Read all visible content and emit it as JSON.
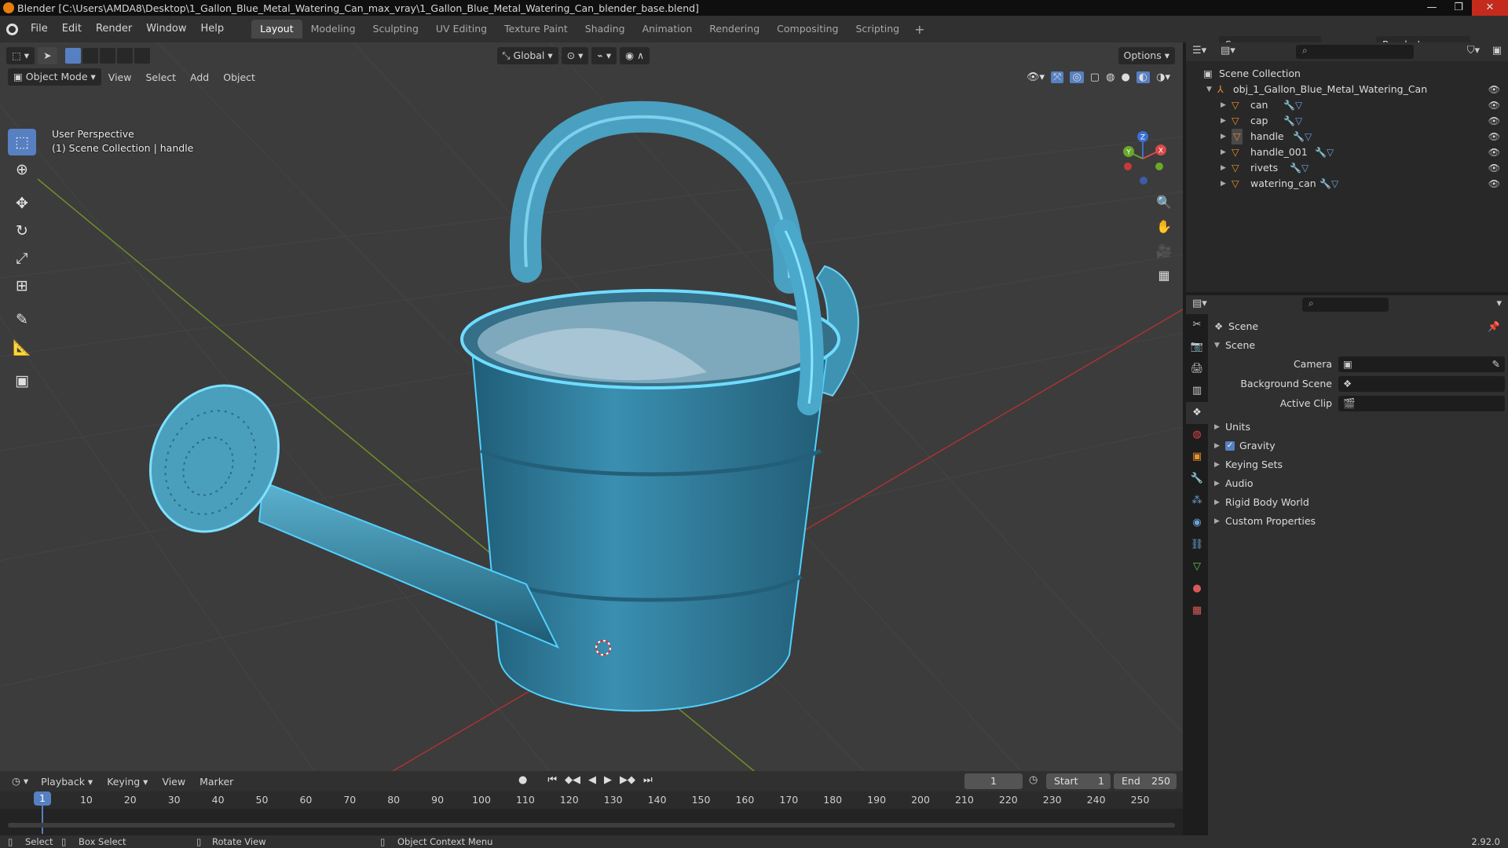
{
  "window": {
    "title": "Blender [C:\\Users\\AMDA8\\Desktop\\1_Gallon_Blue_Metal_Watering_Can_max_vray\\1_Gallon_Blue_Metal_Watering_Can_blender_base.blend]",
    "controls": [
      "—",
      "❐",
      "✕"
    ]
  },
  "menu": [
    "File",
    "Edit",
    "Render",
    "Window",
    "Help"
  ],
  "workspaces": [
    "Layout",
    "Modeling",
    "Sculpting",
    "UV Editing",
    "Texture Paint",
    "Shading",
    "Animation",
    "Rendering",
    "Compositing",
    "Scripting"
  ],
  "active_workspace": "Layout",
  "scene_name": "Scene",
  "view_layer": "RenderLayer",
  "viewport": {
    "mode": "Object Mode",
    "menus": [
      "View",
      "Select",
      "Add",
      "Object"
    ],
    "transform_orientation": "Global",
    "options_label": "Options",
    "info_line1": "User Perspective",
    "info_line2": "(1) Scene Collection | handle",
    "gizmo_axes": [
      "X",
      "Y",
      "Z"
    ]
  },
  "outliner": {
    "root": "Scene Collection",
    "collection": "obj_1_Gallon_Blue_Metal_Watering_Can",
    "objects": [
      "can",
      "cap",
      "handle",
      "handle_001",
      "rivets",
      "watering_can"
    ]
  },
  "properties": {
    "context": "Scene",
    "panel": "Scene",
    "fields": [
      {
        "label": "Camera"
      },
      {
        "label": "Background Scene"
      },
      {
        "label": "Active Clip"
      }
    ],
    "sections": [
      "Units",
      "Gravity",
      "Keying Sets",
      "Audio",
      "Rigid Body World",
      "Custom Properties"
    ],
    "gravity_checked": true
  },
  "timeline": {
    "menus": [
      "Playback",
      "Keying",
      "View",
      "Marker"
    ],
    "current_frame": "1",
    "start_label": "Start",
    "start": "1",
    "end_label": "End",
    "end": "250",
    "ticks": [
      "10",
      "20",
      "30",
      "40",
      "50",
      "60",
      "70",
      "80",
      "90",
      "100",
      "110",
      "120",
      "130",
      "140",
      "150",
      "160",
      "170",
      "180",
      "190",
      "200",
      "210",
      "220",
      "230",
      "240",
      "250"
    ]
  },
  "status": {
    "select": "Select",
    "box_select": "Box Select",
    "rotate_view": "Rotate View",
    "context_menu": "Object Context Menu",
    "version": "2.92.0"
  },
  "colors": {
    "accent": "#5680c2",
    "object_orange": "#e8902e",
    "can_blue": "#2e7fa0",
    "selection_outline": "#52d0ff"
  }
}
